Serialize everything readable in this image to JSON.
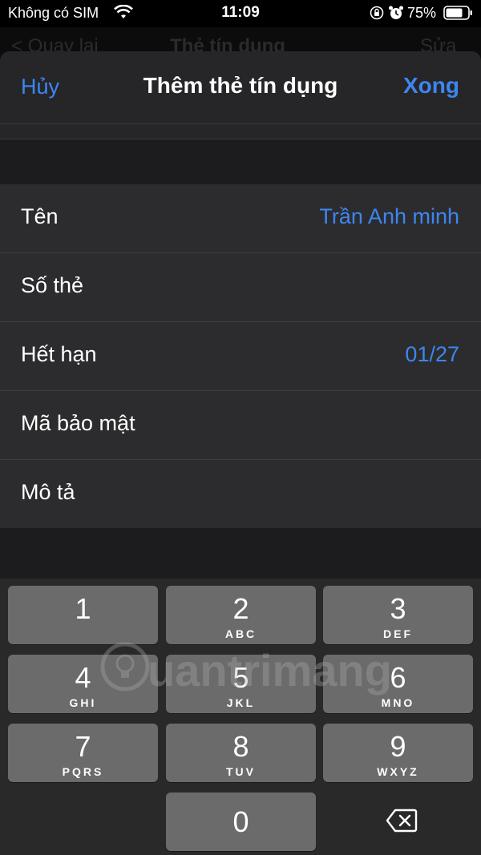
{
  "status_bar": {
    "carrier": "Không có SIM",
    "time": "11:09",
    "battery_percent": "75%"
  },
  "underlying_nav": {
    "back_label": "< Quay lại",
    "title": "Thẻ tín dụng",
    "edit_label": "Sửa"
  },
  "sheet": {
    "cancel_label": "Hủy",
    "title": "Thêm thẻ tín dụng",
    "done_label": "Xong"
  },
  "form": {
    "rows": [
      {
        "label": "Tên",
        "value": "Trần Anh minh"
      },
      {
        "label": "Số thẻ",
        "value": ""
      },
      {
        "label": "Hết hạn",
        "value": "01/27"
      },
      {
        "label": "Mã bảo mật",
        "value": ""
      },
      {
        "label": "Mô tả",
        "value": ""
      }
    ]
  },
  "keypad": {
    "keys": [
      {
        "digit": "1",
        "letters": ""
      },
      {
        "digit": "2",
        "letters": "ABC"
      },
      {
        "digit": "3",
        "letters": "DEF"
      },
      {
        "digit": "4",
        "letters": "GHI"
      },
      {
        "digit": "5",
        "letters": "JKL"
      },
      {
        "digit": "6",
        "letters": "MNO"
      },
      {
        "digit": "7",
        "letters": "PQRS"
      },
      {
        "digit": "8",
        "letters": "TUV"
      },
      {
        "digit": "9",
        "letters": "WXYZ"
      },
      {
        "digit": "0",
        "letters": ""
      }
    ],
    "backspace_icon": "backspace-icon"
  },
  "watermark": {
    "text": "uantrimang",
    "logo_icon": "lightbulb-icon"
  },
  "colors": {
    "accent": "#3d86f0",
    "sheet_bg": "#1c1c1e",
    "row_bg": "#2c2c2e",
    "key_bg": "#6b6b6b",
    "keyboard_bg": "#292929"
  }
}
